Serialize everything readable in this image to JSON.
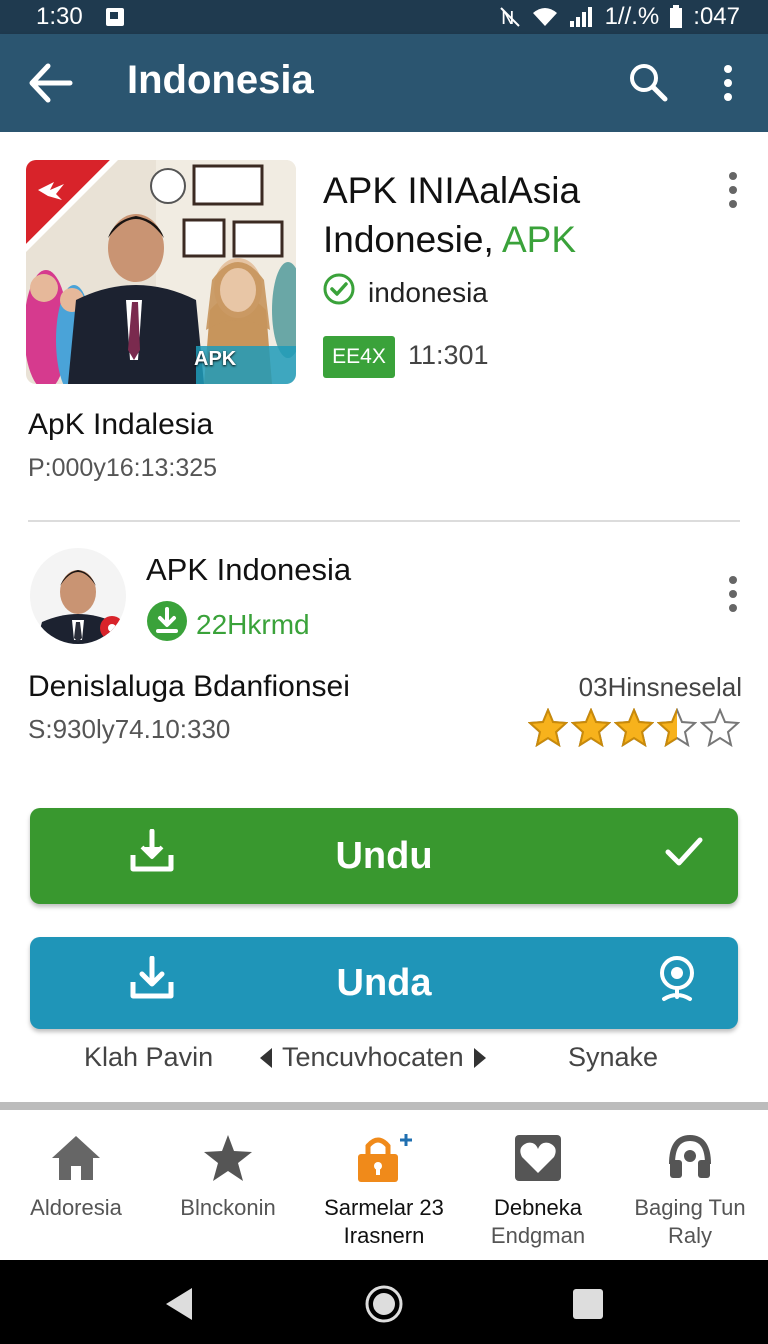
{
  "status_bar": {
    "time": "1:30",
    "right_text": "1//.%",
    "extra_text": ":047",
    "icons": [
      "image-icon",
      "nfc-icon",
      "wifi-icon",
      "signal-icon",
      "battery-icon"
    ]
  },
  "app_bar": {
    "title": "Indonesia",
    "icons": [
      "back-arrow-icon",
      "search-icon",
      "more-vert-icon"
    ]
  },
  "listing": {
    "title_line1": "APK INIAalAsia",
    "title_line2_prefix": "Indonesie, ",
    "title_line2_accent": "APK",
    "verified_text": "indonesia",
    "tag": "EE4X",
    "tag_time": "11:301",
    "app_name": "ApK Indalesia",
    "app_meta": "P:000y16:13:325",
    "thumbnail_badge": "APK"
  },
  "developer": {
    "name": "APK Indonesia",
    "downloads": "22Hkrmd",
    "app_name": "Denislaluga Bdanfionsei",
    "app_meta": "S:930ly74.10:330",
    "rating_label": "03Hinsneselal",
    "rating": 3.5,
    "rating_max": 5
  },
  "buttons": {
    "primary": "Undu",
    "secondary": "Unda"
  },
  "links": [
    "Klah Pavin",
    "Tencuvhocaten",
    "Synake"
  ],
  "bottom_nav": [
    {
      "line1": "Aldoresia",
      "line2": "",
      "icon": "home-icon"
    },
    {
      "line1": "Blnckonin",
      "line2": "",
      "icon": "star-icon"
    },
    {
      "line1": "Sarmelar 23",
      "line2": "Irasnern",
      "icon": "lock-plus-icon"
    },
    {
      "line1": "Debneka",
      "line2": "Endgman",
      "icon": "heart-box-icon"
    },
    {
      "line1": "Baging Tun",
      "line2": "Raly",
      "icon": "headset-icon"
    }
  ],
  "colors": {
    "status_bar": "#1f3a4f",
    "app_bar": "#2b5570",
    "green": "#39982f",
    "blue": "#1f95b8",
    "star": "#f7b21c"
  }
}
